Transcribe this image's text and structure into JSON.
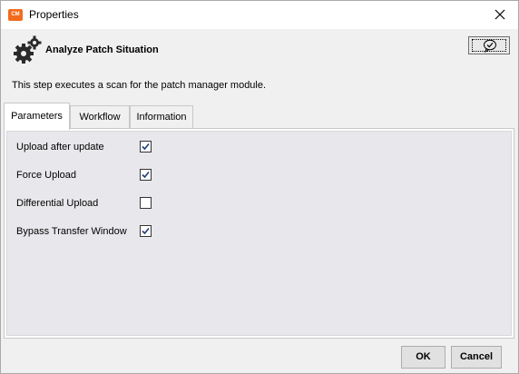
{
  "window": {
    "title": "Properties",
    "app_icon_text": "CM"
  },
  "header": {
    "step_title": "Analyze Patch Situation",
    "description": "This step executes a scan for the patch manager module."
  },
  "tabs": [
    {
      "label": "Parameters",
      "active": true
    },
    {
      "label": "Workflow",
      "active": false
    },
    {
      "label": "Information",
      "active": false
    }
  ],
  "parameters": [
    {
      "label": "Upload after update",
      "checked": true
    },
    {
      "label": "Force Upload",
      "checked": true
    },
    {
      "label": "Differential Upload",
      "checked": false
    },
    {
      "label": "Bypass Transfer Window",
      "checked": true
    }
  ],
  "buttons": {
    "ok": "OK",
    "cancel": "Cancel"
  },
  "colors": {
    "app_icon": "#f26b1d",
    "check": "#1f3f7a"
  }
}
